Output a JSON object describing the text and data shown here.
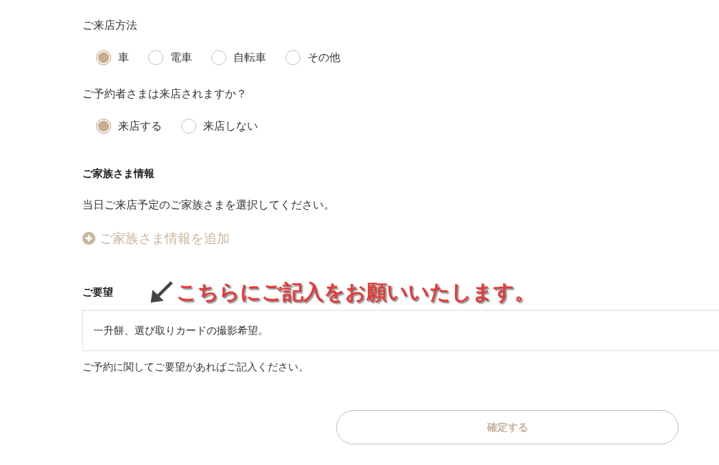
{
  "visit_method": {
    "label": "ご来店方法",
    "options": [
      {
        "label": "車",
        "selected": true
      },
      {
        "label": "電車",
        "selected": false
      },
      {
        "label": "自転車",
        "selected": false
      },
      {
        "label": "その他",
        "selected": false
      }
    ]
  },
  "booker_visit": {
    "label": "ご予約者さまは来店されますか？",
    "options": [
      {
        "label": "来店する",
        "selected": true
      },
      {
        "label": "来店しない",
        "selected": false
      }
    ]
  },
  "family": {
    "heading": "ご家族さま情報",
    "description": "当日ご来店予定のご家族さまを選択してください。",
    "add_link": "ご家族さま情報を追加"
  },
  "request": {
    "label": "ご要望",
    "annotation": "こちらにご記入をお願いいたします。",
    "value": "一升餅、選び取りカードの撮影希望。",
    "hint": "ご予約に関してご要望があればご記入ください。"
  },
  "confirm_button": "確定する"
}
